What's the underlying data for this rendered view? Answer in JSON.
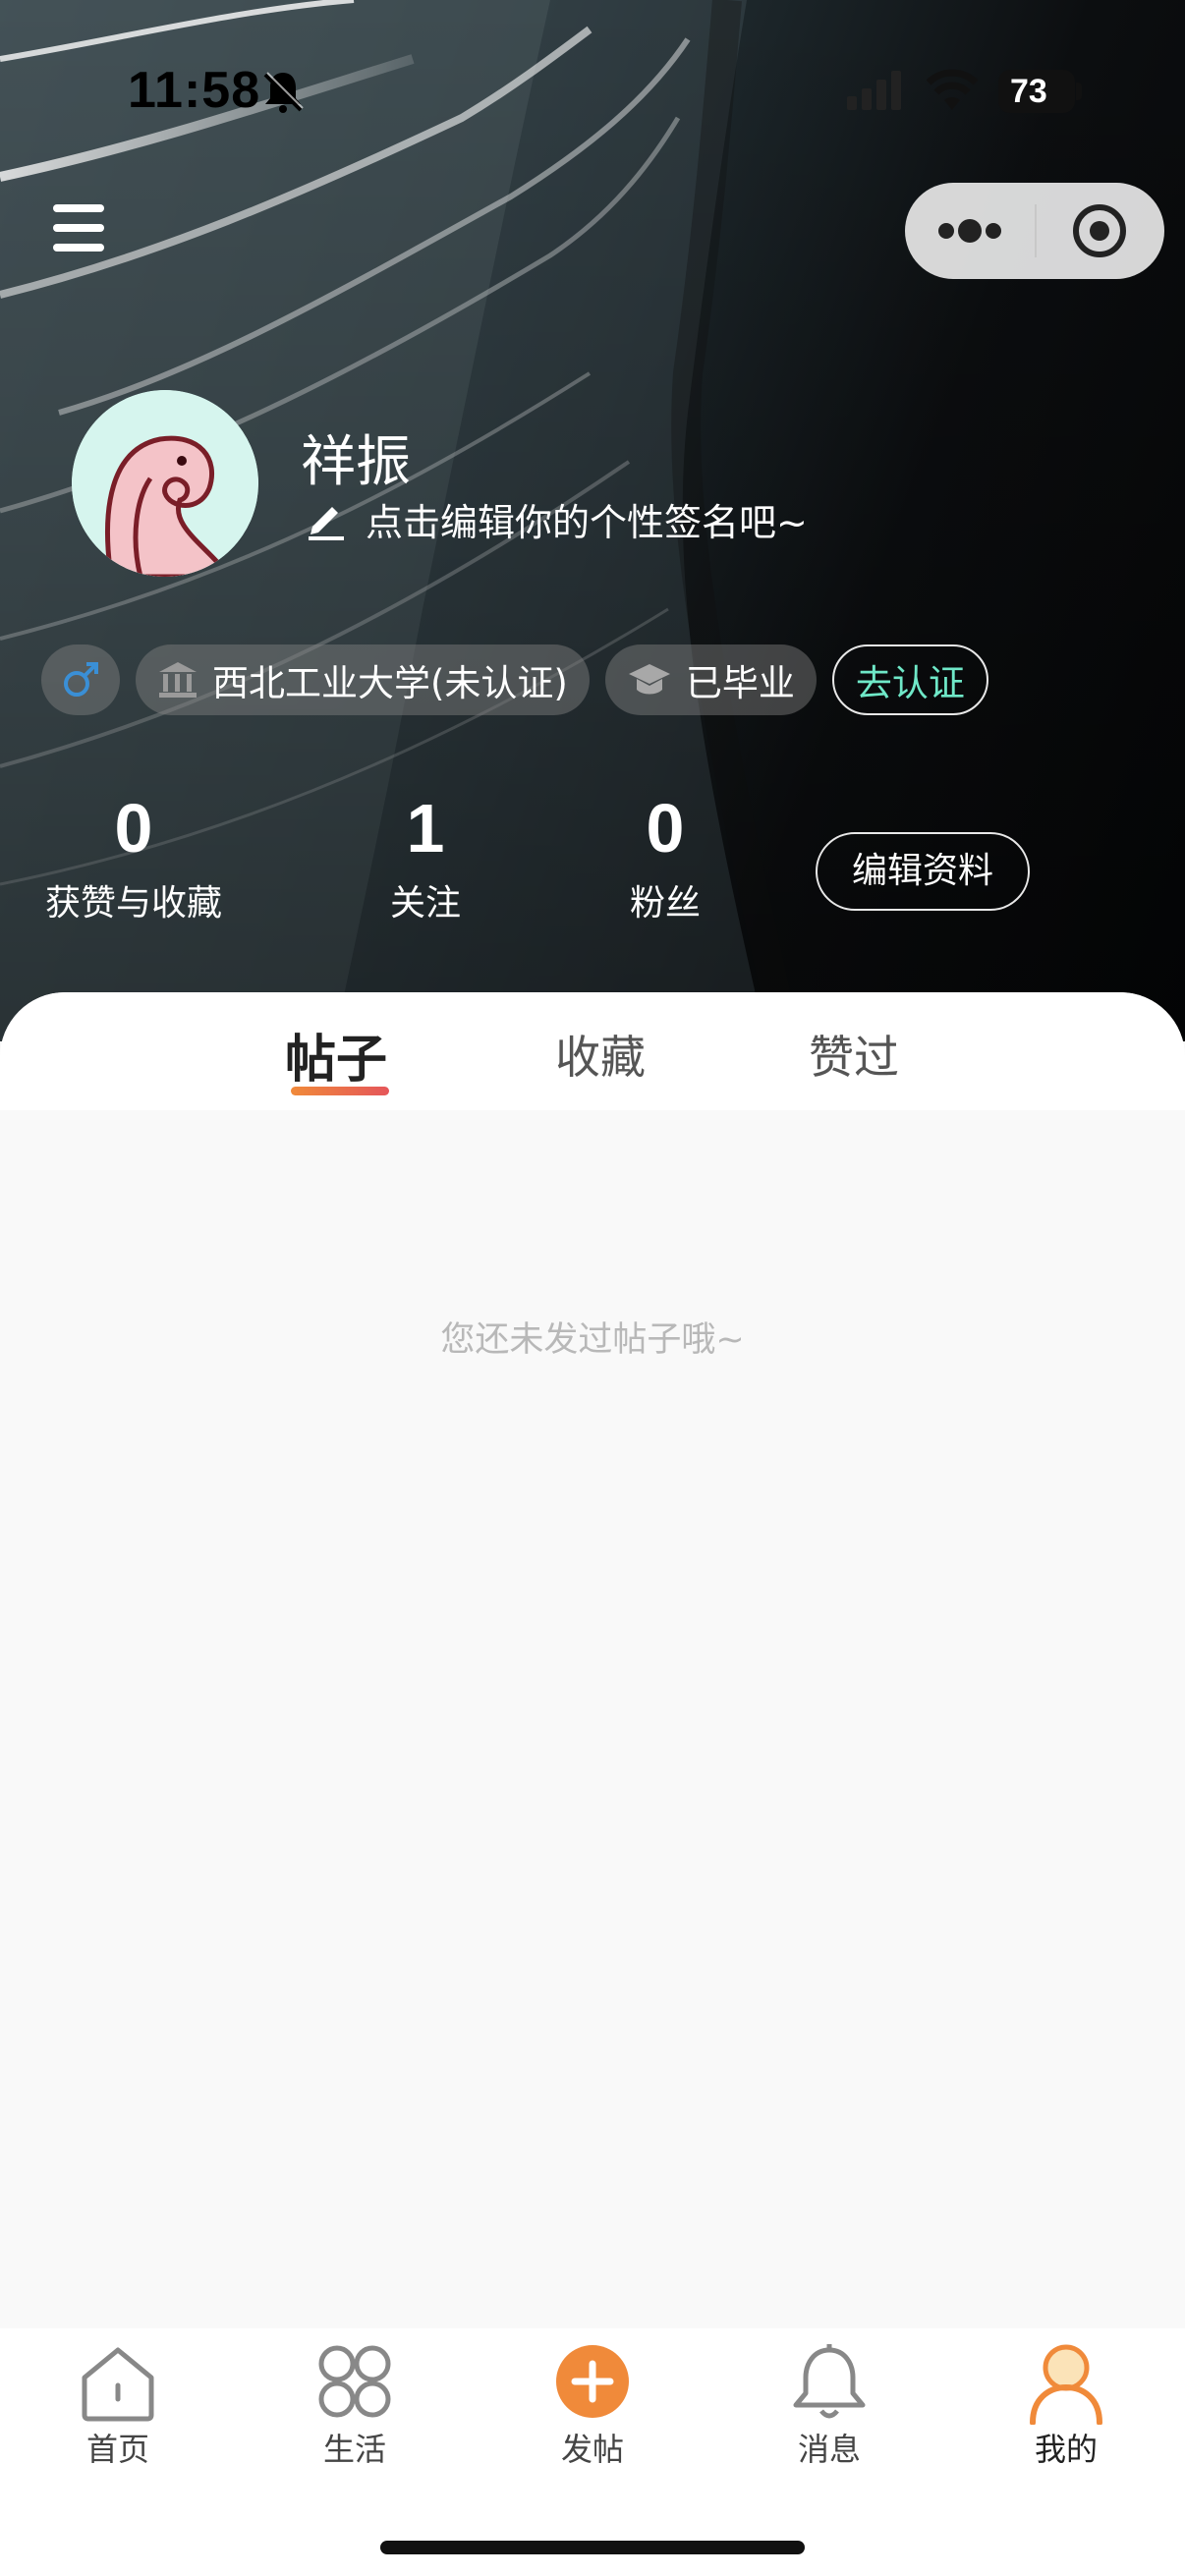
{
  "status_bar": {
    "time": "11:58",
    "battery": "73"
  },
  "profile": {
    "username": "祥振",
    "signature": "点击编辑你的个性签名吧~",
    "tags": {
      "school": "西北工业大学(未认证)",
      "status": "已毕业",
      "verify": "去认证"
    },
    "stats": [
      {
        "value": "0",
        "label": "获赞与收藏"
      },
      {
        "value": "1",
        "label": "关注"
      },
      {
        "value": "0",
        "label": "粉丝"
      }
    ],
    "edit_button": "编辑资料"
  },
  "tabs": [
    {
      "label": "帖子",
      "active": true
    },
    {
      "label": "收藏",
      "active": false
    },
    {
      "label": "赞过",
      "active": false
    }
  ],
  "empty_message": "您还未发过帖子哦~",
  "bottom_nav": [
    {
      "label": "首页",
      "icon": "home-icon"
    },
    {
      "label": "生活",
      "icon": "grid-icon"
    },
    {
      "label": "发帖",
      "icon": "plus-icon"
    },
    {
      "label": "消息",
      "icon": "bell-icon"
    },
    {
      "label": "我的",
      "icon": "user-icon",
      "active": true
    }
  ],
  "colors": {
    "accent_orange": "#f08a3a",
    "verify_green": "#6fe8c8",
    "gender_blue": "#3a8fd6"
  }
}
